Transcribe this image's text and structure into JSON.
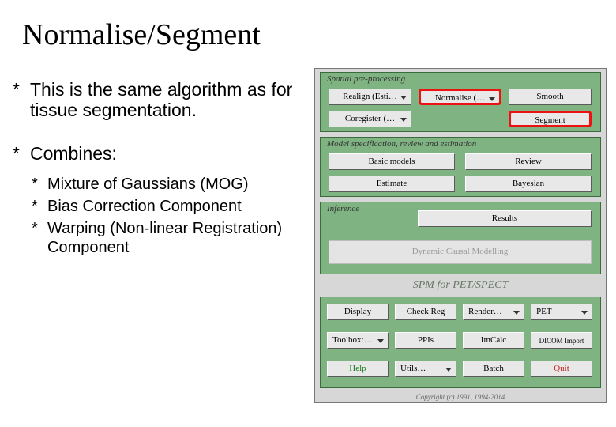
{
  "title": "Normalise/Segment",
  "bullets": {
    "b1": "This is the same algorithm as for tissue segmentation.",
    "b2": "Combines:",
    "sub": {
      "s1": "Mixture of Gaussians (MOG)",
      "s2": "Bias Correction Component",
      "s3": "Warping (Non-linear Registration) Component"
    }
  },
  "panel": {
    "sections": {
      "spatial": "Spatial pre-processing",
      "model": "Model specification, review and estimation",
      "inference": "Inference"
    },
    "buttons": {
      "realign": "Realign (Esti…",
      "normalise": "Normalise (…",
      "smooth": "Smooth",
      "coregister": "Coregister (…",
      "segment": "Segment",
      "basic_models": "Basic models",
      "review": "Review",
      "estimate": "Estimate",
      "bayesian": "Bayesian",
      "results": "Results",
      "dcm": "Dynamic Causal Modelling",
      "display": "Display",
      "check_reg": "Check Reg",
      "render": "Render…",
      "modality": "PET",
      "toolbox": "Toolbox:…",
      "ppis": "PPIs",
      "imcalc": "ImCalc",
      "dicom": "DICOM Import",
      "help": "Help",
      "utils": "Utils…",
      "batch": "Batch",
      "quit": "Quit"
    },
    "spm_label": "SPM for PET/SPECT",
    "copyright": "Copyright (c) 1991, 1994-2014"
  }
}
